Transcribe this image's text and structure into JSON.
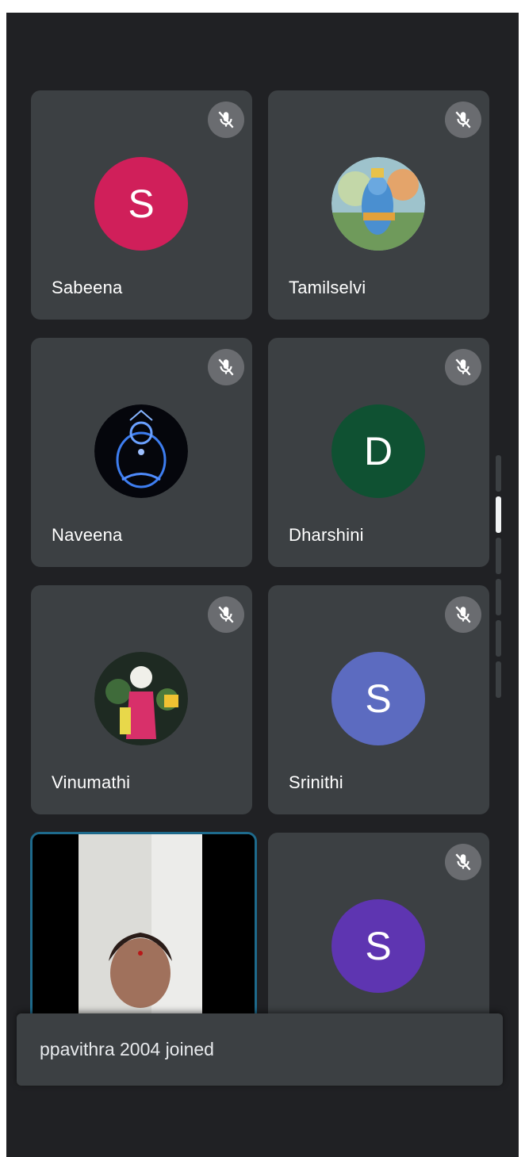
{
  "participants": [
    {
      "name": "Sabeena",
      "initial": "S",
      "avatar_color": "#d01f5a",
      "muted": true
    },
    {
      "name": "Tamilselvi",
      "initial": "",
      "avatar_type": "photo",
      "muted": true
    },
    {
      "name": "Naveena",
      "initial": "",
      "avatar_type": "photo",
      "muted": true
    },
    {
      "name": "Dharshini",
      "initial": "D",
      "avatar_color": "#0f5132",
      "muted": true
    },
    {
      "name": "Vinumathi",
      "initial": "",
      "avatar_type": "photo",
      "muted": true
    },
    {
      "name": "Srinithi",
      "initial": "S",
      "avatar_color": "#5c6bc0",
      "muted": true
    },
    {
      "name": "",
      "avatar_type": "camera",
      "self_view": true
    },
    {
      "name": "",
      "initial": "S",
      "avatar_color": "#5e35b1",
      "muted": true
    }
  ],
  "toast": {
    "message": "ppavithra 2004 joined"
  },
  "icons": {
    "muted": "mic-off-icon"
  },
  "colors": {
    "background": "#202124",
    "tile": "#3c4043",
    "self_view_border": "#1e6a8c"
  }
}
